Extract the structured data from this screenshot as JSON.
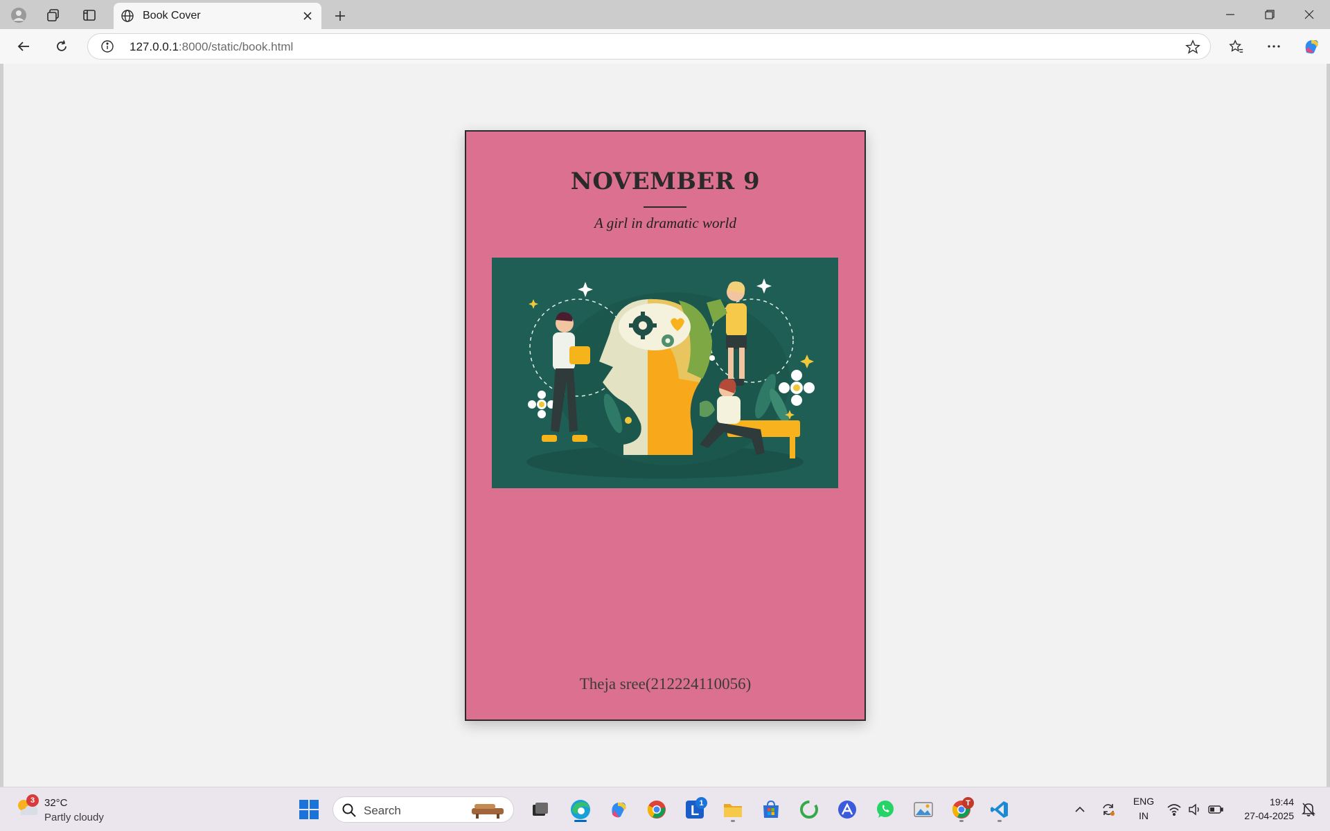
{
  "browser": {
    "tab_title": "Book Cover",
    "url_host": "127.0.0.1",
    "url_path": ":8000/static/book.html"
  },
  "book": {
    "title": "NOVEMBER 9",
    "subtitle": "A girl in dramatic world",
    "author": "Theja sree(212224110056)",
    "background_color": "#dc7090",
    "illustration_bg": "#1f5e54"
  },
  "taskbar": {
    "weather_temp": "32°C",
    "weather_desc": "Partly cloudy",
    "weather_badge": "3",
    "search_placeholder": "Search",
    "l_app_badge": "1",
    "chrome_badge": "T",
    "lang_line1": "ENG",
    "lang_line2": "IN",
    "time": "19:44",
    "date": "27-04-2025"
  }
}
